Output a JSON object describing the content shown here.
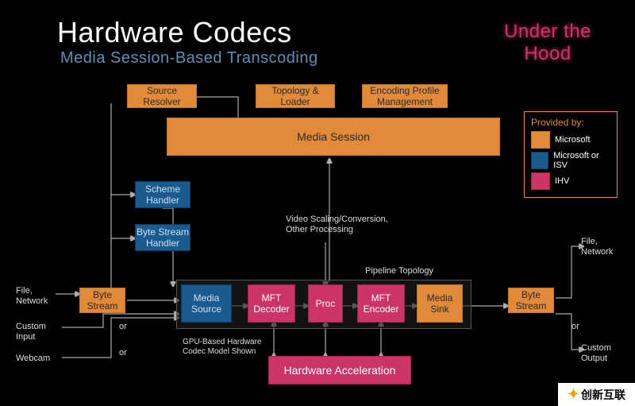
{
  "header": {
    "title": "Hardware Codecs",
    "subtitle": "Media Session-Based Transcoding",
    "corner": "Under the Hood"
  },
  "top_boxes": {
    "source_resolver": "Source Resolver",
    "topology_loader": "Topology & Loader",
    "encoding_profile": "Encoding Profile Management",
    "media_session": "Media Session"
  },
  "mid_boxes": {
    "scheme_handler": "Scheme Handler",
    "byte_stream_handler": "Byte Stream Handler"
  },
  "annotations": {
    "video_proc": "Video Scaling/Conversion, Other Processing",
    "pipeline_topology": "Pipeline Topology",
    "file_network_left": "File, Network",
    "custom_input": "Custom Input",
    "webcam": "Webcam",
    "or1": "or",
    "or2": "or",
    "or_right": "or",
    "file_network_right": "File, Network",
    "custom_output": "Custom Output",
    "gpu_note": "GPU-Based Hardware Codec Model Shown"
  },
  "pipeline": {
    "byte_stream_in": "Byte Stream",
    "media_source": "Media Source",
    "mft_decoder": "MFT Decoder",
    "proc": "Proc",
    "mft_encoder": "MFT Encoder",
    "media_sink": "Media Sink",
    "byte_stream_out": "Byte Stream",
    "hw_accel": "Hardware Acceleration"
  },
  "legend": {
    "title": "Provided by:",
    "microsoft": "Microsoft",
    "microsoft_isv": "Microsoft or ISV",
    "ihv": "IHV"
  },
  "watermark": "创新互联"
}
